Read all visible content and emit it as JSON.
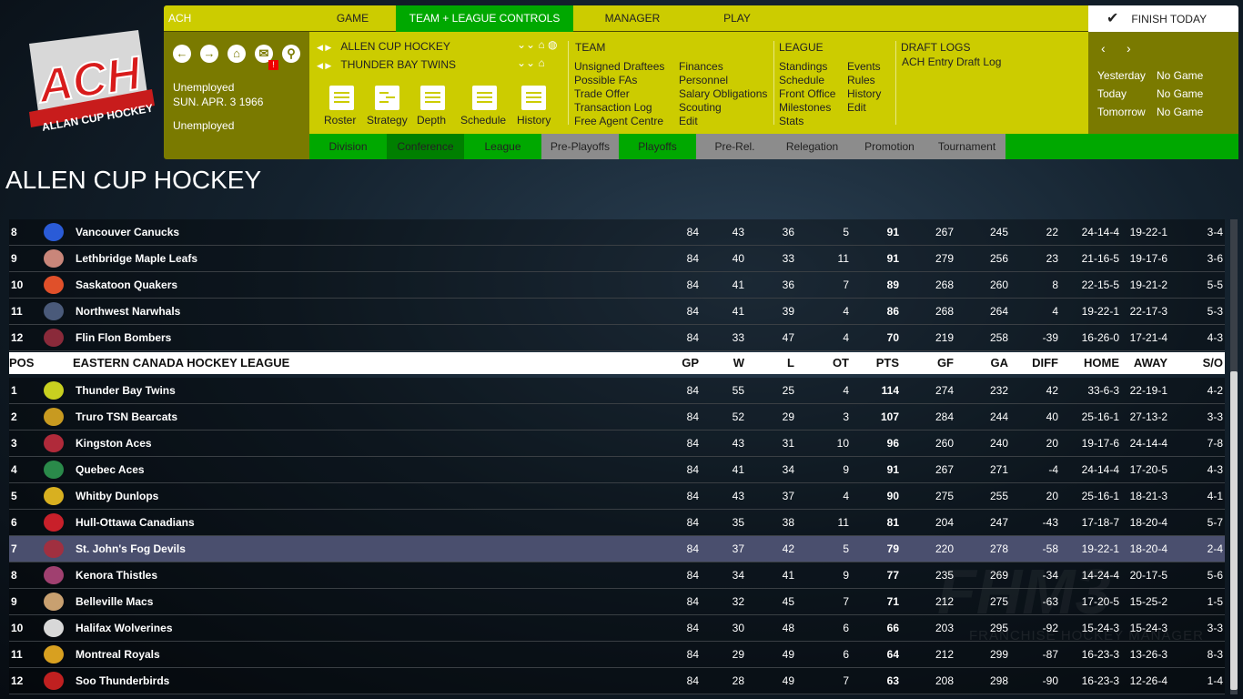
{
  "logo": {
    "text": "ACH",
    "subtext": "ALLAN CUP HOCKEY"
  },
  "topbar": {
    "league_abbr": "ACH",
    "tabs": [
      "GAME",
      "TEAM + LEAGUE CONTROLS",
      "MANAGER",
      "PLAY"
    ],
    "active_tab": 1,
    "finish_label": "FINISH TODAY"
  },
  "left": {
    "alert": "!",
    "status1": "Unemployed",
    "date": "SUN. APR. 3 1966",
    "status2": "Unemployed"
  },
  "selectors": {
    "league": "ALLEN CUP HOCKEY",
    "team": "THUNDER BAY TWINS"
  },
  "shortcuts": [
    "Roster",
    "Strategy",
    "Depth",
    "Schedule",
    "History"
  ],
  "team_menu": {
    "title": "TEAM",
    "col1": [
      "Unsigned Draftees",
      "Possible FAs",
      "Trade Offer",
      "Transaction Log",
      "Free Agent Centre"
    ],
    "col2": [
      "Finances",
      "Personnel",
      "Salary Obligations",
      "Scouting",
      "Edit"
    ]
  },
  "league_menu": {
    "title": "LEAGUE",
    "col1": [
      "Standings",
      "Schedule",
      "Front Office",
      "Milestones",
      "Stats"
    ],
    "col2": [
      "Events",
      "Rules",
      "History",
      "Edit"
    ]
  },
  "draft_menu": {
    "title": "DRAFT LOGS",
    "items": [
      "ACH Entry Draft Log"
    ]
  },
  "games": [
    {
      "label": "Yesterday",
      "value": "No Game"
    },
    {
      "label": "Today",
      "value": "No Game"
    },
    {
      "label": "Tomorrow",
      "value": "No Game"
    }
  ],
  "subtabs": [
    {
      "label": "Division",
      "state": "green"
    },
    {
      "label": "Conference",
      "state": "active"
    },
    {
      "label": "League",
      "state": "green"
    },
    {
      "label": "Pre-Playoffs",
      "state": "gray"
    },
    {
      "label": "Playoffs",
      "state": "green"
    },
    {
      "label": "Pre-Rel.",
      "state": "gray"
    },
    {
      "label": "Relegation",
      "state": "gray"
    },
    {
      "label": "Promotion",
      "state": "gray"
    },
    {
      "label": "Tournament",
      "state": "gray"
    }
  ],
  "colors": {
    "yellow": "#cccc00",
    "olive": "#7a7a00",
    "green": "#00a800",
    "active_green": "#007f00",
    "gray": "#8c8c8c",
    "selected_row": "#4a4f6e"
  },
  "page_title": "ALLEN CUP HOCKEY",
  "columns": [
    "GP",
    "W",
    "L",
    "OT",
    "PTS",
    "GF",
    "GA",
    "DIFF",
    "HOME",
    "AWAY",
    "S/O"
  ],
  "header": {
    "pos": "POS",
    "league": "EASTERN CANADA HOCKEY LEAGUE"
  },
  "western_rows": [
    [
      "8",
      "Vancouver Canucks",
      "84",
      "43",
      "36",
      "5",
      "91",
      "267",
      "245",
      "22",
      "24-14-4",
      "19-22-1",
      "3-4"
    ],
    [
      "9",
      "Lethbridge Maple Leafs",
      "84",
      "40",
      "33",
      "11",
      "91",
      "279",
      "256",
      "23",
      "21-16-5",
      "19-17-6",
      "3-6"
    ],
    [
      "10",
      "Saskatoon Quakers",
      "84",
      "41",
      "36",
      "7",
      "89",
      "268",
      "260",
      "8",
      "22-15-5",
      "19-21-2",
      "5-5"
    ],
    [
      "11",
      "Northwest Narwhals",
      "84",
      "41",
      "39",
      "4",
      "86",
      "268",
      "264",
      "4",
      "19-22-1",
      "22-17-3",
      "5-3"
    ],
    [
      "12",
      "Flin Flon Bombers",
      "84",
      "33",
      "47",
      "4",
      "70",
      "219",
      "258",
      "-39",
      "16-26-0",
      "17-21-4",
      "4-3"
    ]
  ],
  "eastern_rows": [
    [
      "1",
      "Thunder Bay Twins",
      "84",
      "55",
      "25",
      "4",
      "114",
      "274",
      "232",
      "42",
      "33-6-3",
      "22-19-1",
      "4-2"
    ],
    [
      "2",
      "Truro TSN Bearcats",
      "84",
      "52",
      "29",
      "3",
      "107",
      "284",
      "244",
      "40",
      "25-16-1",
      "27-13-2",
      "3-3"
    ],
    [
      "3",
      "Kingston Aces",
      "84",
      "43",
      "31",
      "10",
      "96",
      "260",
      "240",
      "20",
      "19-17-6",
      "24-14-4",
      "7-8"
    ],
    [
      "4",
      "Quebec Aces",
      "84",
      "41",
      "34",
      "9",
      "91",
      "267",
      "271",
      "-4",
      "24-14-4",
      "17-20-5",
      "4-3"
    ],
    [
      "5",
      "Whitby Dunlops",
      "84",
      "43",
      "37",
      "4",
      "90",
      "275",
      "255",
      "20",
      "25-16-1",
      "18-21-3",
      "4-1"
    ],
    [
      "6",
      "Hull-Ottawa Canadians",
      "84",
      "35",
      "38",
      "11",
      "81",
      "204",
      "247",
      "-43",
      "17-18-7",
      "18-20-4",
      "5-7"
    ],
    [
      "7",
      "St. John's Fog Devils",
      "84",
      "37",
      "42",
      "5",
      "79",
      "220",
      "278",
      "-58",
      "19-22-1",
      "18-20-4",
      "2-4"
    ],
    [
      "8",
      "Kenora Thistles",
      "84",
      "34",
      "41",
      "9",
      "77",
      "235",
      "269",
      "-34",
      "14-24-4",
      "20-17-5",
      "5-6"
    ],
    [
      "9",
      "Belleville Macs",
      "84",
      "32",
      "45",
      "7",
      "71",
      "212",
      "275",
      "-63",
      "17-20-5",
      "15-25-2",
      "1-5"
    ],
    [
      "10",
      "Halifax Wolverines",
      "84",
      "30",
      "48",
      "6",
      "66",
      "203",
      "295",
      "-92",
      "15-24-3",
      "15-24-3",
      "3-3"
    ],
    [
      "11",
      "Montreal Royals",
      "84",
      "29",
      "49",
      "6",
      "64",
      "212",
      "299",
      "-87",
      "16-23-3",
      "13-26-3",
      "8-3"
    ],
    [
      "12",
      "Soo Thunderbirds",
      "84",
      "28",
      "49",
      "7",
      "63",
      "208",
      "298",
      "-90",
      "16-23-3",
      "12-26-4",
      "1-4"
    ]
  ],
  "selected_team": "St. John's Fog Devils",
  "team_logo_colors": [
    "#2a5bd7",
    "#c9867a",
    "#e0502a",
    "#4a5a7a",
    "#8a2a3a",
    "#c8d020",
    "#c89a20",
    "#b02a3a",
    "#2a8a4a",
    "#d8b020",
    "#c8202a",
    "#a03040",
    "#a04070",
    "#c8a070",
    "#d8d8d8",
    "#d8a020",
    "#c02020"
  ],
  "watermark": {
    "big": "FHM3",
    "small": "FRANCHISE HOCKEY MANAGER"
  }
}
